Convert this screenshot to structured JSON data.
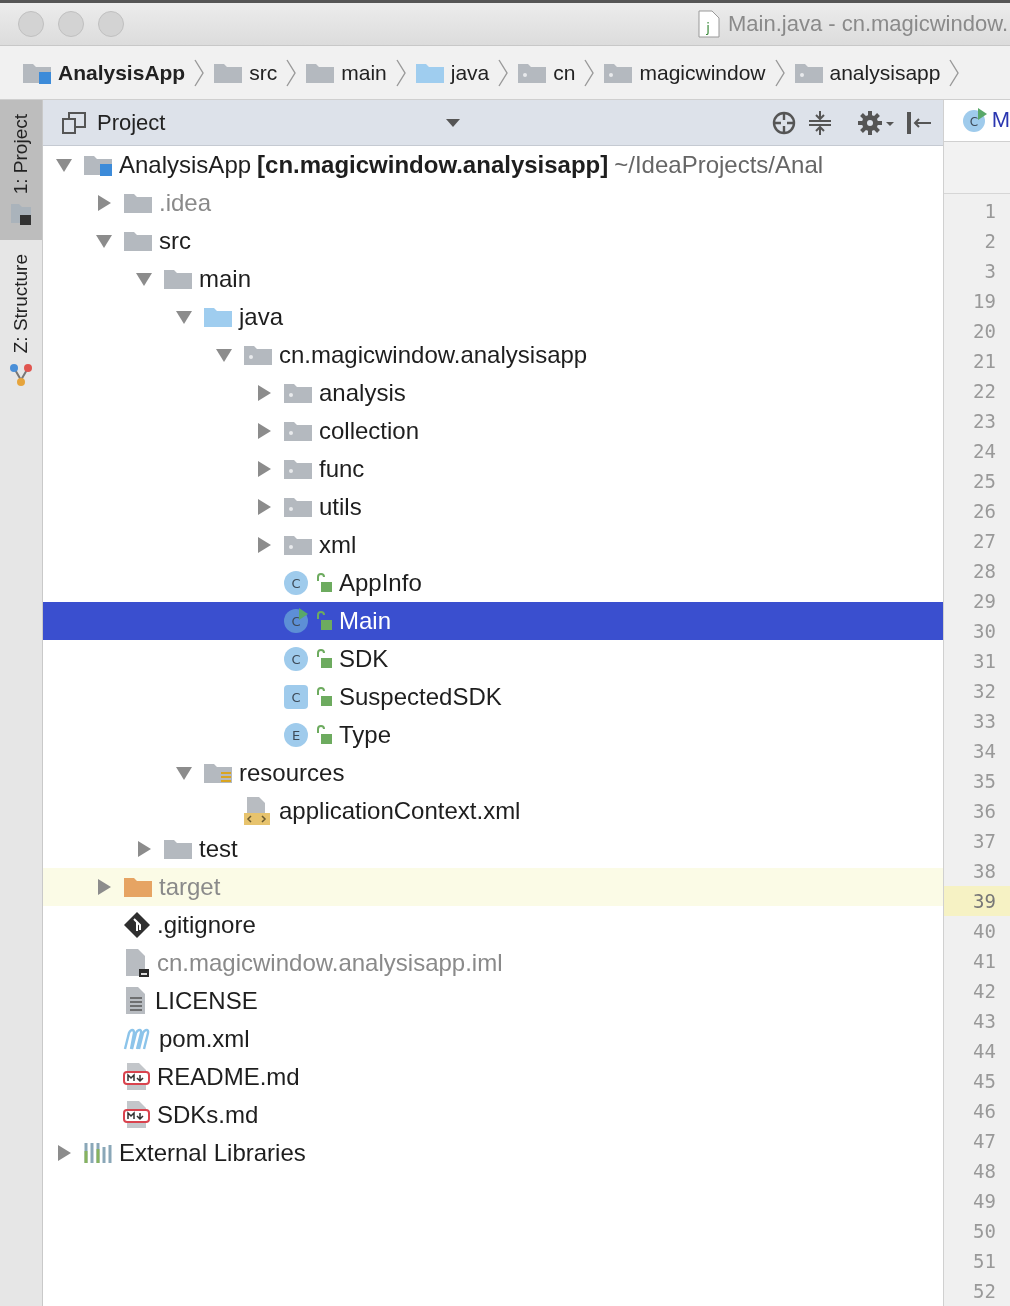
{
  "window": {
    "title": "Main.java - cn.magicwindow.",
    "file_badge": "j"
  },
  "breadcrumbs": [
    {
      "label": "AnalysisApp",
      "kind": "module"
    },
    {
      "label": "src",
      "kind": "folder"
    },
    {
      "label": "main",
      "kind": "folder"
    },
    {
      "label": "java",
      "kind": "source"
    },
    {
      "label": "cn",
      "kind": "package"
    },
    {
      "label": "magicwindow",
      "kind": "package"
    },
    {
      "label": "analysisapp",
      "kind": "package"
    }
  ],
  "side_tabs": [
    {
      "label": "1: Project",
      "kind": "project",
      "selected": true
    },
    {
      "label": "Z: Structure",
      "kind": "structure",
      "selected": false
    }
  ],
  "panel": {
    "title": "Project"
  },
  "editor_tab": {
    "label": "M",
    "badge": "C"
  },
  "tree": [
    {
      "label": "AnalysisApp",
      "module": "[cn.magicwindow.analysisapp]",
      "path": "~/IdeaProjects/Anal",
      "kind": "module",
      "expanded": true,
      "selected": false,
      "dimmed": false,
      "highlighted": false,
      "children": [
        {
          "label": ".idea",
          "kind": "folder",
          "expanded": false,
          "selected": false,
          "dimmed": true,
          "highlighted": false
        },
        {
          "label": "src",
          "kind": "folder",
          "expanded": true,
          "selected": false,
          "dimmed": false,
          "highlighted": false,
          "children": [
            {
              "label": "main",
              "kind": "folder",
              "expanded": true,
              "selected": false,
              "dimmed": false,
              "highlighted": false,
              "children": [
                {
                  "label": "java",
                  "kind": "source",
                  "expanded": true,
                  "selected": false,
                  "dimmed": false,
                  "highlighted": false,
                  "children": [
                    {
                      "label": "cn.magicwindow.analysisapp",
                      "kind": "package",
                      "expanded": true,
                      "selected": false,
                      "dimmed": false,
                      "highlighted": false,
                      "children": [
                        {
                          "label": "analysis",
                          "kind": "package",
                          "expanded": false,
                          "selected": false,
                          "dimmed": false,
                          "highlighted": false
                        },
                        {
                          "label": "collection",
                          "kind": "package",
                          "expanded": false,
                          "selected": false,
                          "dimmed": false,
                          "highlighted": false
                        },
                        {
                          "label": "func",
                          "kind": "package",
                          "expanded": false,
                          "selected": false,
                          "dimmed": false,
                          "highlighted": false
                        },
                        {
                          "label": "utils",
                          "kind": "package",
                          "expanded": false,
                          "selected": false,
                          "dimmed": false,
                          "highlighted": false
                        },
                        {
                          "label": "xml",
                          "kind": "package",
                          "expanded": false,
                          "selected": false,
                          "dimmed": false,
                          "highlighted": false
                        },
                        {
                          "label": "AppInfo",
                          "kind": "class",
                          "badge": "C",
                          "selected": false,
                          "dimmed": false,
                          "highlighted": false
                        },
                        {
                          "label": "Main",
                          "kind": "main-class",
                          "badge": "C",
                          "selected": true,
                          "dimmed": false,
                          "highlighted": false
                        },
                        {
                          "label": "SDK",
                          "kind": "class",
                          "badge": "C",
                          "selected": false,
                          "dimmed": false,
                          "highlighted": false
                        },
                        {
                          "label": "SuspectedSDK",
                          "kind": "abstract-class",
                          "badge": "C",
                          "selected": false,
                          "dimmed": false,
                          "highlighted": false
                        },
                        {
                          "label": "Type",
                          "kind": "class",
                          "badge": "E",
                          "selected": false,
                          "dimmed": false,
                          "highlighted": false
                        }
                      ]
                    }
                  ]
                },
                {
                  "label": "resources",
                  "kind": "resources",
                  "expanded": true,
                  "selected": false,
                  "dimmed": false,
                  "highlighted": false,
                  "children": [
                    {
                      "label": "applicationContext.xml",
                      "kind": "xml",
                      "selected": false,
                      "dimmed": false,
                      "highlighted": false
                    }
                  ]
                }
              ]
            },
            {
              "label": "test",
              "kind": "folder",
              "expanded": false,
              "selected": false,
              "dimmed": false,
              "highlighted": false
            }
          ]
        },
        {
          "label": "target",
          "kind": "excluded",
          "expanded": false,
          "selected": false,
          "dimmed": true,
          "highlighted": true
        },
        {
          "label": ".gitignore",
          "kind": "git",
          "selected": false,
          "dimmed": false,
          "highlighted": false
        },
        {
          "label": "cn.magicwindow.analysisapp.iml",
          "kind": "iml",
          "selected": false,
          "dimmed": true,
          "highlighted": false
        },
        {
          "label": "LICENSE",
          "kind": "text",
          "selected": false,
          "dimmed": false,
          "highlighted": false
        },
        {
          "label": "pom.xml",
          "kind": "maven",
          "selected": false,
          "dimmed": false,
          "highlighted": false
        },
        {
          "label": "README.md",
          "kind": "markdown",
          "selected": false,
          "dimmed": false,
          "highlighted": false
        },
        {
          "label": "SDKs.md",
          "kind": "markdown",
          "selected": false,
          "dimmed": false,
          "highlighted": false
        }
      ]
    },
    {
      "label": "External Libraries",
      "kind": "libraries",
      "expanded": false,
      "selected": false,
      "dimmed": false,
      "highlighted": false
    }
  ],
  "gutter": [
    {
      "number": "1",
      "current": false
    },
    {
      "number": "2",
      "current": false
    },
    {
      "number": "3",
      "current": false
    },
    {
      "number": "19",
      "current": false
    },
    {
      "number": "20",
      "current": false
    },
    {
      "number": "21",
      "current": false
    },
    {
      "number": "22",
      "current": false
    },
    {
      "number": "23",
      "current": false
    },
    {
      "number": "24",
      "current": false
    },
    {
      "number": "25",
      "current": false
    },
    {
      "number": "26",
      "current": false
    },
    {
      "number": "27",
      "current": false
    },
    {
      "number": "28",
      "current": false
    },
    {
      "number": "29",
      "current": false
    },
    {
      "number": "30",
      "current": false
    },
    {
      "number": "31",
      "current": false
    },
    {
      "number": "32",
      "current": false
    },
    {
      "number": "33",
      "current": false
    },
    {
      "number": "34",
      "current": false
    },
    {
      "number": "35",
      "current": false
    },
    {
      "number": "36",
      "current": false
    },
    {
      "number": "37",
      "current": false
    },
    {
      "number": "38",
      "current": false
    },
    {
      "number": "39",
      "current": true
    },
    {
      "number": "40",
      "current": false
    },
    {
      "number": "41",
      "current": false
    },
    {
      "number": "42",
      "current": false
    },
    {
      "number": "43",
      "current": false
    },
    {
      "number": "44",
      "current": false
    },
    {
      "number": "45",
      "current": false
    },
    {
      "number": "46",
      "current": false
    },
    {
      "number": "47",
      "current": false
    },
    {
      "number": "48",
      "current": false
    },
    {
      "number": "49",
      "current": false
    },
    {
      "number": "50",
      "current": false
    },
    {
      "number": "51",
      "current": false
    },
    {
      "number": "52",
      "current": false
    }
  ]
}
